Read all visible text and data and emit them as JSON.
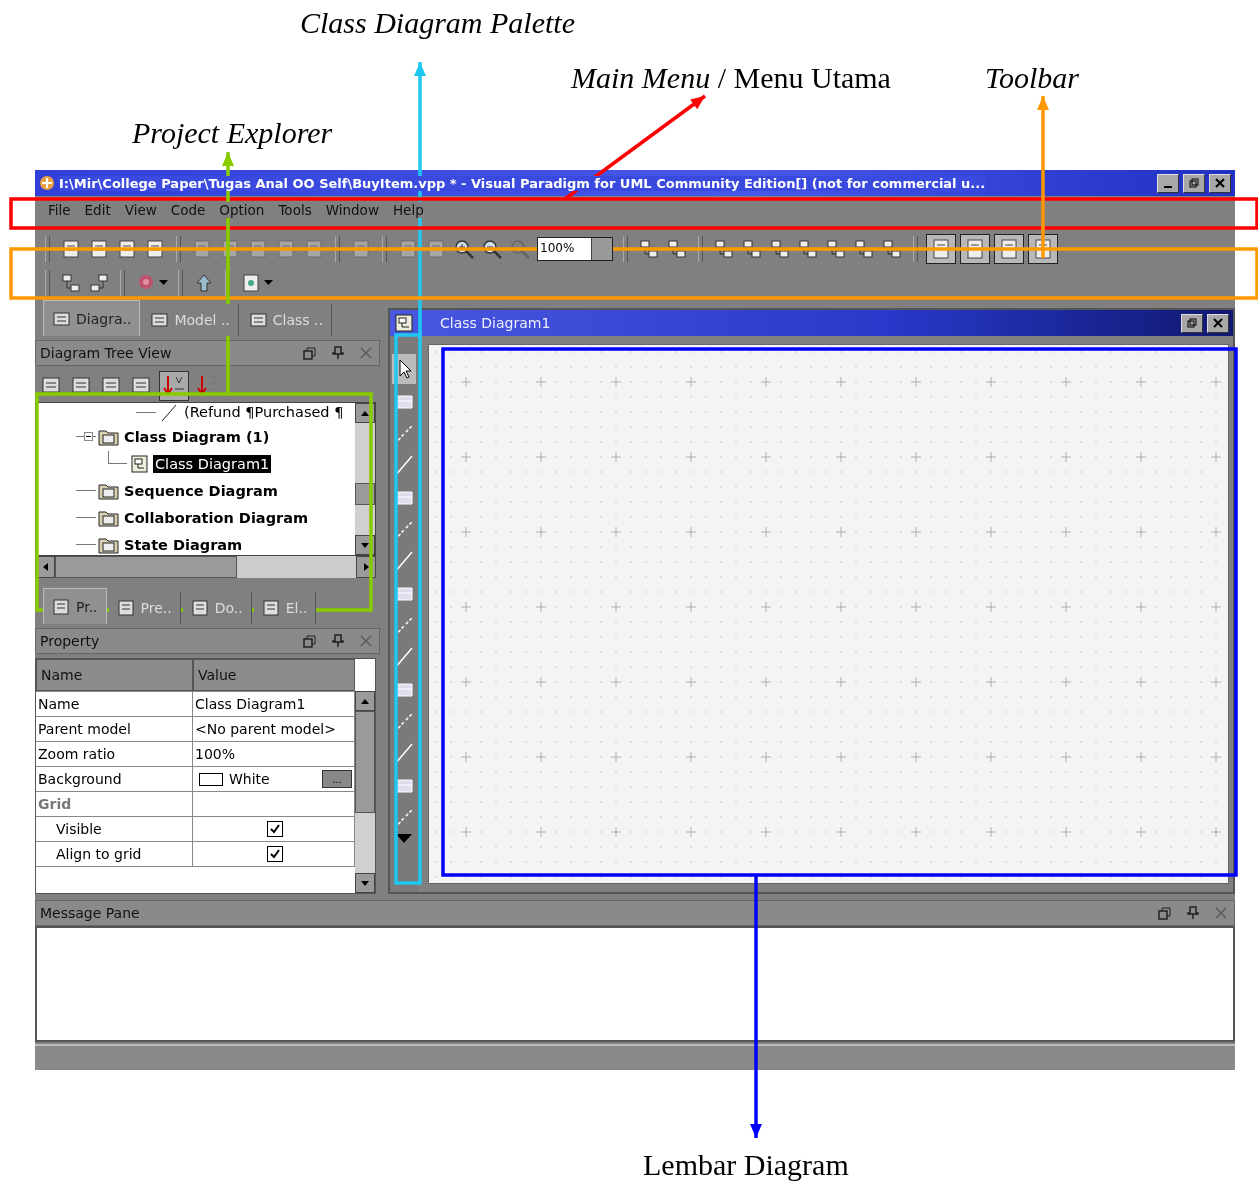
{
  "annotations": [
    {
      "label": "Class Diagram Palette",
      "italic": true,
      "color": "#1ec8f0"
    },
    {
      "label": "*Main Menu* / Menu Utama",
      "italic": false,
      "color": "#ff0000"
    },
    {
      "label": "Toolbar",
      "italic": true,
      "color": "#ff9900"
    },
    {
      "label": "Project Explorer",
      "italic": true,
      "color": "#88cc00"
    },
    {
      "label": "Lembar Diagram",
      "italic": false,
      "color": "#0000ff"
    }
  ],
  "window": {
    "title": "I:\\Mir\\College Paper\\Tugas Anal OO Self\\BuyItem.vpp * - Visual Paradigm for UML Community Edition[] (not for commercial u..."
  },
  "menu": [
    "File",
    "Edit",
    "View",
    "Code",
    "Option",
    "Tools",
    "Window",
    "Help"
  ],
  "toolbar": {
    "zoom": "100%"
  },
  "explorer_tabs": [
    {
      "label": "Diagra..",
      "selected": true
    },
    {
      "label": "Model ..",
      "selected": false
    },
    {
      "label": "Class ..",
      "selected": false
    }
  ],
  "tree_panel": {
    "title": "Diagram Tree View",
    "items": [
      {
        "label": "(Refund ¶Purchased ¶",
        "bold": false,
        "selected": false
      },
      {
        "label": "Class Diagram (1)",
        "bold": true,
        "selected": false,
        "expanded": true,
        "children": [
          {
            "label": "Class Diagram1",
            "bold": false,
            "selected": true
          }
        ]
      },
      {
        "label": "Sequence Diagram",
        "bold": true,
        "selected": false
      },
      {
        "label": "Collaboration Diagram",
        "bold": true,
        "selected": false
      },
      {
        "label": "State Diagram",
        "bold": true,
        "selected": false
      }
    ]
  },
  "property_tabs": [
    {
      "label": "Pr..",
      "selected": true
    },
    {
      "label": "Pre..",
      "selected": false
    },
    {
      "label": "Do..",
      "selected": false
    },
    {
      "label": "El..",
      "selected": false
    }
  ],
  "property_panel": {
    "title": "Property",
    "columns": [
      "Name",
      "Value"
    ],
    "rows": [
      {
        "kind": "text",
        "name": "Name",
        "value": "Class Diagram1"
      },
      {
        "kind": "text",
        "name": "Parent model",
        "value": "<No parent model>"
      },
      {
        "kind": "text",
        "name": "Zoom ratio",
        "value": "100%"
      },
      {
        "kind": "color",
        "name": "Background",
        "value": "White",
        "button": "..."
      },
      {
        "kind": "group",
        "name": "Grid",
        "children": [
          {
            "kind": "checkbox",
            "name": "Visible",
            "checked": true
          },
          {
            "kind": "checkbox",
            "name": "Align to grid",
            "checked": true
          }
        ]
      }
    ]
  },
  "diagram_window": {
    "title": "Class Diagram1"
  },
  "message_pane": {
    "title": "Message Pane"
  }
}
